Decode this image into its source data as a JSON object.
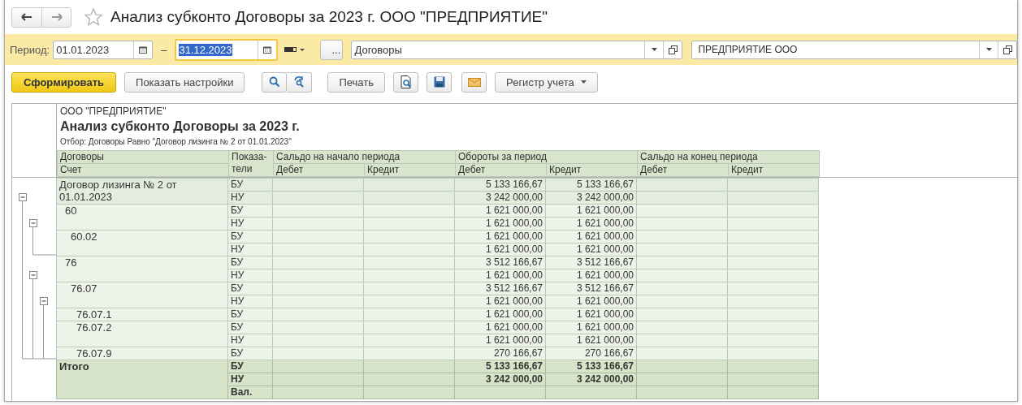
{
  "window": {
    "title": "Анализ субконто Договоры за 2023 г. ООО \"ПРЕДПРИЯТИЕ\"",
    "favorite": false
  },
  "filters": {
    "period_label": "Период:",
    "date_from": "01.01.2023",
    "dash": "–",
    "date_to": "31.12.2023",
    "date_to_focused": true,
    "more_button": "...",
    "subconto": "Договоры",
    "organization": "ПРЕДПРИЯТИЕ ООО"
  },
  "toolbar": [
    [
      {
        "kind": "primary",
        "label": "Сформировать"
      }
    ],
    [
      {
        "kind": "text",
        "label": "Показать настройки"
      }
    ],
    [
      {
        "kind": "search"
      },
      {
        "kind": "search-refresh"
      }
    ],
    [
      {
        "kind": "text",
        "label": "Печать"
      }
    ],
    [
      {
        "kind": "preview"
      }
    ],
    [
      {
        "kind": "save"
      }
    ],
    [
      {
        "kind": "mail"
      }
    ],
    [
      {
        "kind": "menu",
        "label": "Регистр учета"
      }
    ]
  ],
  "report": {
    "organization": "ООО \"ПРЕДПРИЯТИЕ\"",
    "title": "Анализ субконто Договоры за 2023 г.",
    "filter": "Отбор: Договоры Равно \"Договор лизинга № 2 от 01.01.2023\"",
    "columns": {
      "group": "Договоры",
      "account": "Счет",
      "indicator": "Показа-тели",
      "sections": [
        {
          "label": "Сальдо на начало периода",
          "debit": "Дебет",
          "credit": "Кредит"
        },
        {
          "label": "Обороты за период",
          "debit": "Дебет",
          "credit": "Кредит"
        },
        {
          "label": "Сальдо на конец периода",
          "debit": "Дебет",
          "credit": "Кредит"
        }
      ]
    },
    "rows": [
      {
        "name": "Договор лизинга № 2 от 01.01.2023",
        "expanded": true,
        "lines": [
          {
            "indicator": "БУ",
            "turnover_debit": "5 133 166,67",
            "turnover_credit": "5 133 166,67"
          },
          {
            "indicator": "НУ",
            "turnover_debit": "3 242 000,00",
            "turnover_credit": "3 242 000,00"
          }
        ],
        "children": [
          {
            "name": "60",
            "expanded": true,
            "lines": [
              {
                "indicator": "БУ",
                "turnover_debit": "1 621 000,00",
                "turnover_credit": "1 621 000,00"
              },
              {
                "indicator": "НУ",
                "turnover_debit": "1 621 000,00",
                "turnover_credit": "1 621 000,00"
              }
            ],
            "children": [
              {
                "name": "60.02",
                "lines": [
                  {
                    "indicator": "БУ",
                    "turnover_debit": "1 621 000,00",
                    "turnover_credit": "1 621 000,00"
                  },
                  {
                    "indicator": "НУ",
                    "turnover_debit": "1 621 000,00",
                    "turnover_credit": "1 621 000,00"
                  }
                ]
              }
            ]
          },
          {
            "name": "76",
            "expanded": true,
            "lines": [
              {
                "indicator": "БУ",
                "turnover_debit": "3 512 166,67",
                "turnover_credit": "3 512 166,67"
              },
              {
                "indicator": "НУ",
                "turnover_debit": "1 621 000,00",
                "turnover_credit": "1 621 000,00"
              }
            ],
            "children": [
              {
                "name": "76.07",
                "expanded": true,
                "lines": [
                  {
                    "indicator": "БУ",
                    "turnover_debit": "3 512 166,67",
                    "turnover_credit": "3 512 166,67"
                  },
                  {
                    "indicator": "НУ",
                    "turnover_debit": "1 621 000,00",
                    "turnover_credit": "1 621 000,00"
                  }
                ],
                "children": [
                  {
                    "name": "76.07.1",
                    "lines": [
                      {
                        "indicator": "БУ",
                        "turnover_debit": "1 621 000,00",
                        "turnover_credit": "1 621 000,00"
                      }
                    ]
                  },
                  {
                    "name": "76.07.2",
                    "lines": [
                      {
                        "indicator": "БУ",
                        "turnover_debit": "1 621 000,00",
                        "turnover_credit": "1 621 000,00"
                      },
                      {
                        "indicator": "НУ",
                        "turnover_debit": "1 621 000,00",
                        "turnover_credit": "1 621 000,00"
                      }
                    ]
                  },
                  {
                    "name": "76.07.9",
                    "lines": [
                      {
                        "indicator": "БУ",
                        "turnover_debit": "270 166,67",
                        "turnover_credit": "270 166,67"
                      }
                    ]
                  }
                ]
              }
            ]
          }
        ]
      }
    ],
    "total": {
      "name": "Итого",
      "lines": [
        {
          "indicator": "БУ",
          "turnover_debit": "5 133 166,67",
          "turnover_credit": "5 133 166,67"
        },
        {
          "indicator": "НУ",
          "turnover_debit": "3 242 000,00",
          "turnover_credit": "3 242 000,00"
        },
        {
          "indicator": "Вал."
        }
      ]
    }
  }
}
